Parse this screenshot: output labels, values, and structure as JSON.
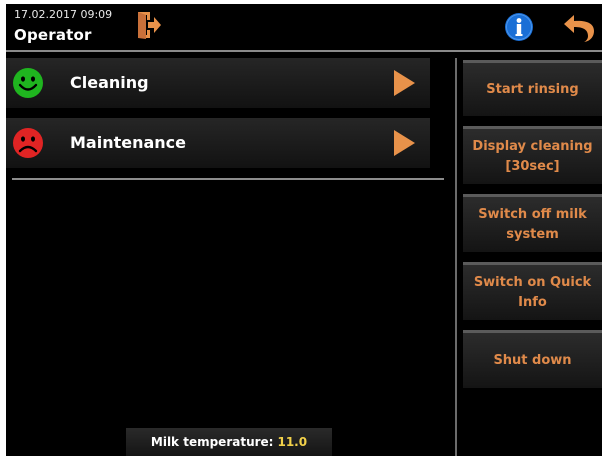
{
  "header": {
    "datetime": "17.02.2017 09:09",
    "user": "Operator",
    "icons": [
      "logout-icon",
      "info-icon",
      "back-arrow-icon"
    ]
  },
  "menu": {
    "items": [
      {
        "label": "Cleaning",
        "status": "good",
        "status_icon": "smiley-happy-icon",
        "status_color": "#1fb51f"
      },
      {
        "label": "Maintenance",
        "status": "bad",
        "status_icon": "smiley-sad-icon",
        "status_color": "#e02424"
      }
    ]
  },
  "side_buttons": [
    {
      "label": "Start rinsing"
    },
    {
      "label": "Display cleaning\n[30sec]"
    },
    {
      "label": "Switch off milk\nsystem"
    },
    {
      "label": "Switch on Quick\nInfo"
    },
    {
      "label": "Shut down"
    }
  ],
  "status": {
    "label": "Milk temperature:",
    "value": "11.0"
  },
  "colors": {
    "accent_orange": "#e8924a",
    "button_text": "#e08a4a",
    "info_blue": "#1a6fd6",
    "value_yellow": "#f2d14a",
    "background": "#000000"
  }
}
